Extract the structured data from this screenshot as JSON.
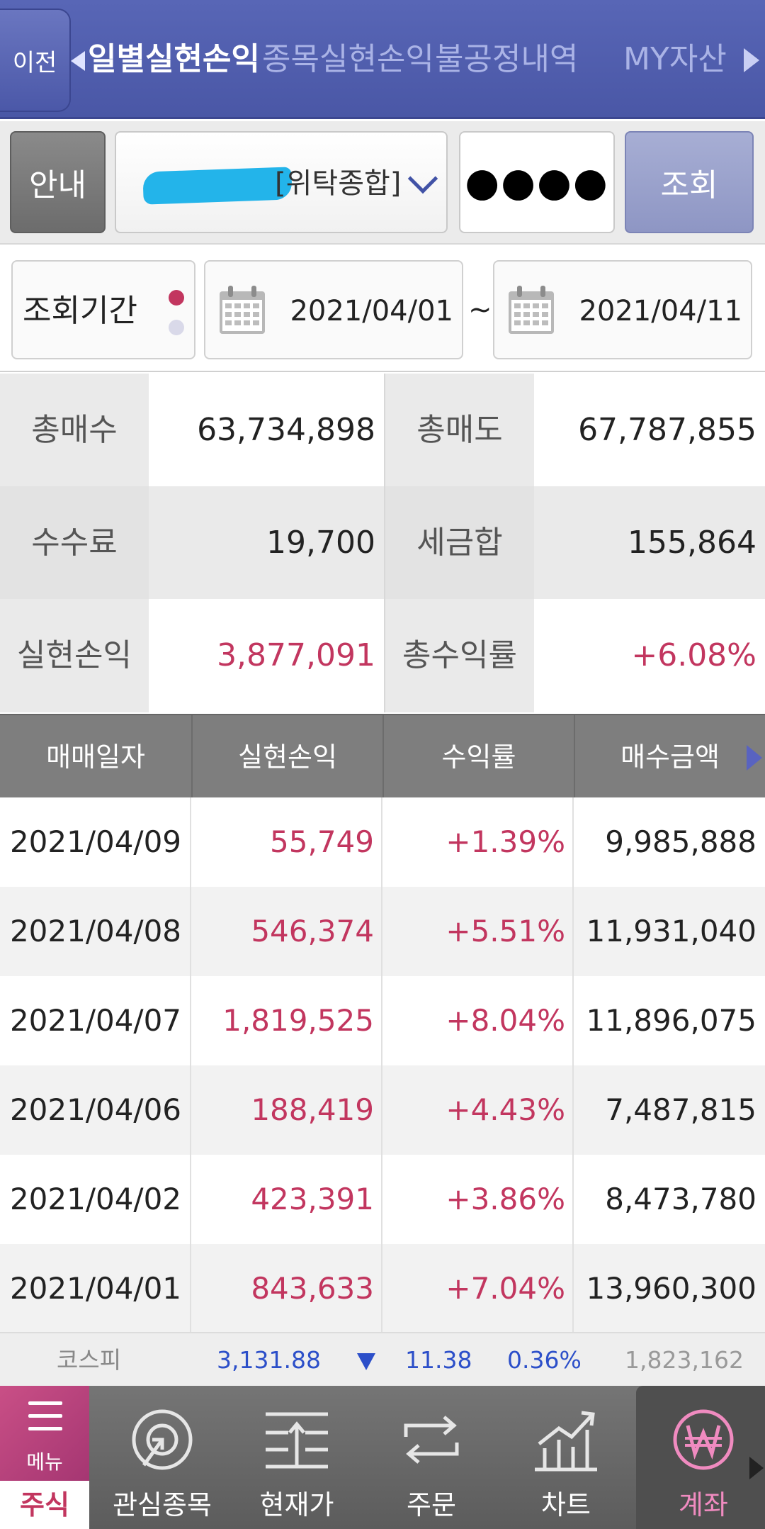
{
  "topbar": {
    "back_label": "이전",
    "tabs": [
      {
        "label": "일별실현손익",
        "active": true
      },
      {
        "label": "종목실현손익",
        "active": false
      },
      {
        "label": "불공정내역",
        "active": false
      },
      {
        "label": "MY자산",
        "active": false
      }
    ]
  },
  "account": {
    "info_button": "안내",
    "account_type": "[위탁종합]",
    "password_mask": "●●●●",
    "query_button": "조회"
  },
  "period": {
    "label": "조회기간",
    "start_date": "2021/04/01",
    "separator": "~",
    "end_date": "2021/04/11"
  },
  "summary": {
    "total_buy_label": "총매수",
    "total_buy_value": "63,734,898",
    "total_sell_label": "총매도",
    "total_sell_value": "67,787,855",
    "fee_label": "수수료",
    "fee_value": "19,700",
    "tax_label": "세금합",
    "tax_value": "155,864",
    "realized_pnl_label": "실현손익",
    "realized_pnl_value": "3,877,091",
    "total_return_label": "총수익률",
    "total_return_value": "+6.08%"
  },
  "table": {
    "headers": [
      "매매일자",
      "실현손익",
      "수익률",
      "매수금액"
    ],
    "rows": [
      {
        "date": "2021/04/09",
        "pnl": "55,749",
        "rate": "+1.39%",
        "buy": "9,985,888"
      },
      {
        "date": "2021/04/08",
        "pnl": "546,374",
        "rate": "+5.51%",
        "buy": "11,931,040"
      },
      {
        "date": "2021/04/07",
        "pnl": "1,819,525",
        "rate": "+8.04%",
        "buy": "11,896,075"
      },
      {
        "date": "2021/04/06",
        "pnl": "188,419",
        "rate": "+4.43%",
        "buy": "7,487,815"
      },
      {
        "date": "2021/04/02",
        "pnl": "423,391",
        "rate": "+3.86%",
        "buy": "8,473,780"
      },
      {
        "date": "2021/04/01",
        "pnl": "843,633",
        "rate": "+7.04%",
        "buy": "13,960,300"
      }
    ]
  },
  "ticker": {
    "name": "코스피",
    "index": "3,131.88",
    "change": "11.38",
    "change_pct": "0.36%",
    "volume": "1,823,162"
  },
  "bottomnav": {
    "menu_label": "메뉴",
    "stock_label": "주식",
    "items": [
      {
        "label": "관심종목",
        "icon": "watchlist-icon"
      },
      {
        "label": "현재가",
        "icon": "current-price-icon"
      },
      {
        "label": "주문",
        "icon": "order-icon"
      },
      {
        "label": "차트",
        "icon": "chart-icon"
      },
      {
        "label": "계좌",
        "icon": "account-won-icon",
        "active": true
      }
    ]
  },
  "colors": {
    "accent_pink": "#c2365f",
    "topbar_blue": "#4a57a6",
    "ticker_blue": "#2c4fc9"
  }
}
